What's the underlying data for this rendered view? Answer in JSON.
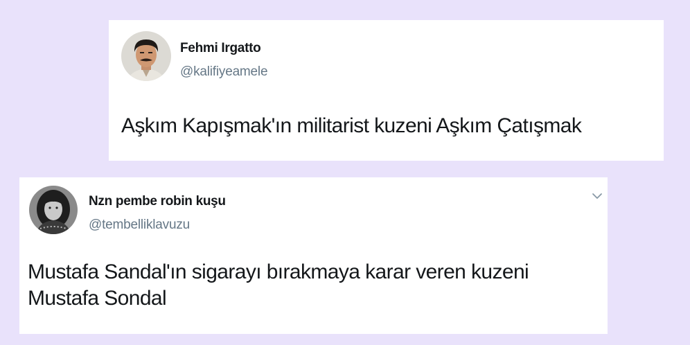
{
  "tweets": [
    {
      "name": "Fehmi Irgatto",
      "handle": "@kalifiyeamele",
      "text": "Aşkım Kapışmak'ın militarist kuzeni Aşkım Çatışmak"
    },
    {
      "name": "Nzn pembe robin kuşu",
      "handle": "@tembelliklavuzu",
      "text_line1": "Mustafa Sandal'ın sigarayı bırakmaya karar veren kuzeni",
      "text_line2": "Mustafa Sondal"
    }
  ],
  "colors": {
    "background": "#e9e2fb",
    "card": "#ffffff",
    "text": "#14171a",
    "handle": "#657786"
  },
  "icons": [
    "chevron-down-icon"
  ]
}
